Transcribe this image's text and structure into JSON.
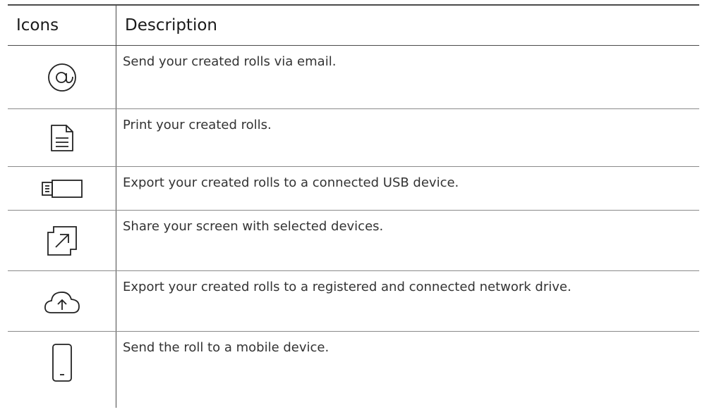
{
  "table": {
    "headers": {
      "icons": "Icons",
      "description": "Description"
    },
    "rows": [
      {
        "icon": "email-at-icon",
        "description": "Send your created rolls via email."
      },
      {
        "icon": "print-document-icon",
        "description": "Print your created rolls."
      },
      {
        "icon": "usb-device-icon",
        "description": "Export your created rolls to a connected USB device."
      },
      {
        "icon": "screen-share-icon",
        "description": "Share your screen with selected devices."
      },
      {
        "icon": "cloud-upload-icon",
        "description": "Export your created rolls to a registered and connected network drive."
      },
      {
        "icon": "mobile-device-icon",
        "description": "Send the roll to a mobile device."
      }
    ]
  }
}
